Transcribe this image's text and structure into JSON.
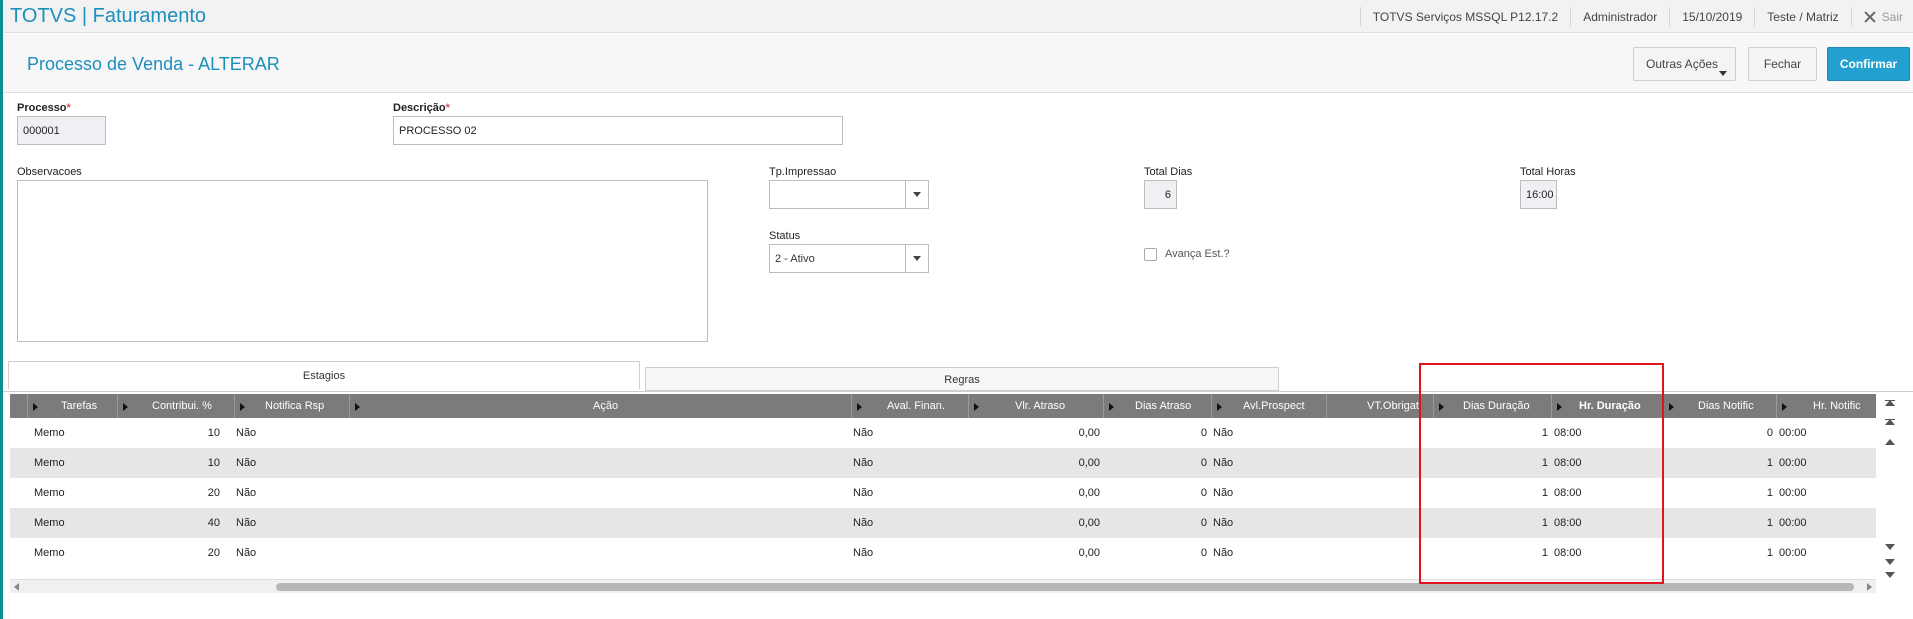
{
  "app": {
    "title": "TOTVS | Faturamento"
  },
  "topbar": {
    "environment": "TOTVS Serviços MSSQL P12.17.2",
    "user": "Administrador",
    "date": "15/10/2019",
    "company": "Teste / Matriz",
    "exit_label": "Sair"
  },
  "header": {
    "title": "Processo de Venda - ALTERAR",
    "other_actions": "Outras Ações",
    "close": "Fechar",
    "confirm": "Confirmar"
  },
  "form": {
    "processo_label": "Processo",
    "processo_value": "000001",
    "descricao_label": "Descrição",
    "descricao_value": "PROCESSO 02",
    "required_mark": "*",
    "observacoes_label": "Observacoes",
    "tp_impressao_label": "Tp.Impressao",
    "tp_impressao_value": "",
    "status_label": "Status",
    "status_value": "2 - Ativo",
    "total_dias_label": "Total Dias",
    "total_dias_value": "6",
    "total_horas_label": "Total Horas",
    "total_horas_value": "16:00",
    "avanca_label": "Avança Est.?"
  },
  "tabs": [
    {
      "label": "Estagios"
    },
    {
      "label": "Regras"
    }
  ],
  "grid": {
    "columns": [
      "Tarefas",
      "Contribui. %",
      "Notifica Rsp",
      "Ação",
      "Aval. Finan.",
      "Vlr. Atraso",
      "Dias Atraso",
      "Avl.Prospect",
      "VT.Obrigat",
      "Dias Duração",
      "Hr. Duração",
      "Dias Notific",
      "Hr. Notific"
    ],
    "rows": [
      [
        "Memo",
        "10",
        "Não",
        "",
        "Não",
        "0,00",
        "0",
        "Não",
        "",
        "1",
        "08:00",
        "0",
        "00:00"
      ],
      [
        "Memo",
        "10",
        "Não",
        "",
        "Não",
        "0,00",
        "0",
        "Não",
        "",
        "1",
        "08:00",
        "1",
        "00:00"
      ],
      [
        "Memo",
        "20",
        "Não",
        "",
        "Não",
        "0,00",
        "0",
        "Não",
        "",
        "1",
        "08:00",
        "1",
        "00:00"
      ],
      [
        "Memo",
        "40",
        "Não",
        "",
        "Não",
        "0,00",
        "0",
        "Não",
        "",
        "1",
        "08:00",
        "1",
        "00:00"
      ],
      [
        "Memo",
        "20",
        "Não",
        "",
        "Não",
        "0,00",
        "0",
        "Não",
        "",
        "1",
        "08:00",
        "1",
        "00:00"
      ]
    ]
  },
  "colors": {
    "accent": "#1b8fbd",
    "confirm_bg": "#22a0cf",
    "highlight_box": "#e0141e",
    "grid_header": "#7b7b7b"
  }
}
